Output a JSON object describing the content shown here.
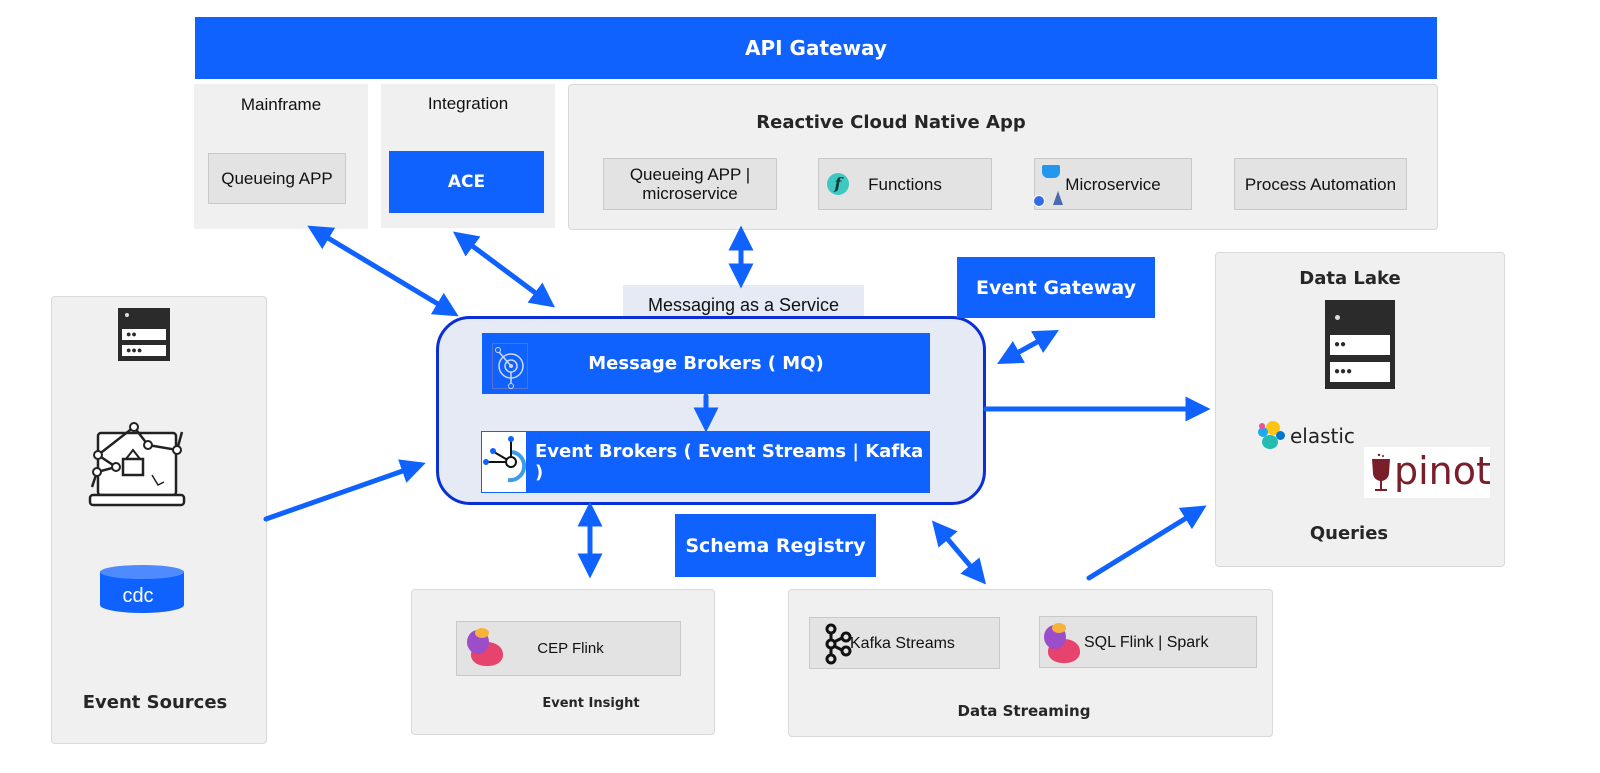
{
  "api_gateway": {
    "label": "API Gateway"
  },
  "mainframe": {
    "title": "Mainframe",
    "item": "Queueing APP"
  },
  "integration": {
    "title": "Integration",
    "item": "ACE"
  },
  "reactive_app": {
    "title": "Reactive Cloud Native App",
    "items": [
      {
        "label": "Queueing APP | microservice",
        "icon": "none"
      },
      {
        "label": "Functions",
        "icon": "functions-icon"
      },
      {
        "label": "Microservice",
        "icon": "docker-kubernetes-icon"
      },
      {
        "label": "Process Automation",
        "icon": "none"
      }
    ]
  },
  "messaging": {
    "title": "Messaging as a Service",
    "message_brokers": "Message Brokers ( MQ)",
    "event_brokers": "Event Brokers ( Event Streams | Kafka )"
  },
  "event_gateway": {
    "label": "Event Gateway"
  },
  "schema_registry": {
    "label": "Schema Registry"
  },
  "event_sources": {
    "title": "Event Sources",
    "cdc_label": "cdc",
    "icons": [
      "server-icon",
      "ecommerce-laptop-icon",
      "database-icon"
    ]
  },
  "data_lake": {
    "title": "Data Lake",
    "elastic_label": "elastic",
    "pinot_label": "pinot",
    "queries_label": "Queries"
  },
  "event_insight": {
    "title": "Event Insight",
    "item": "CEP Flink"
  },
  "data_streaming": {
    "title": "Data Streaming",
    "items": [
      "Kafka Streams",
      "SQL Flink | Spark"
    ]
  },
  "colors": {
    "accent": "#0f62fe",
    "panel": "#f0f0f0",
    "chip": "#e3e3e3",
    "maas_bg": "#e5eaf5",
    "maas_border": "#0a2fd6"
  }
}
